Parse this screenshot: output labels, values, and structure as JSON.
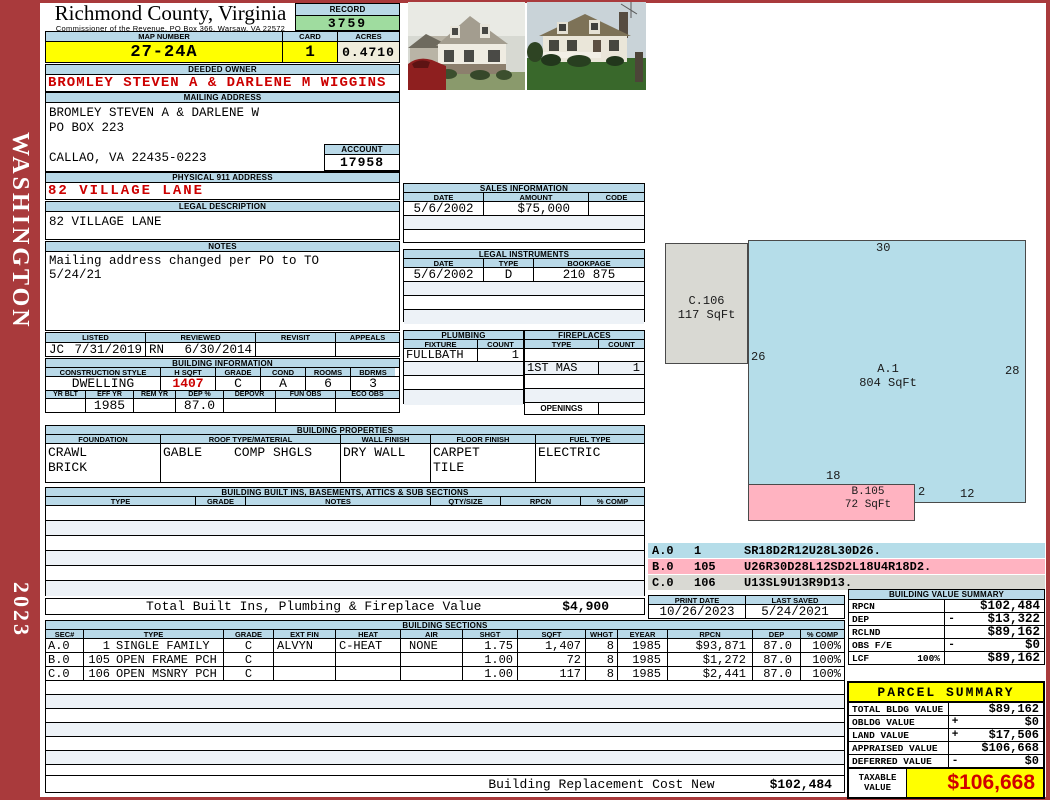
{
  "sidebar": {
    "district": "WASHINGTON",
    "year": "2023"
  },
  "header": {
    "title": "Richmond County, Virginia",
    "subtitle": "Commissioner of the Revenue, PO Box 366, Warsaw, VA 22572",
    "record_label": "RECORD",
    "record_value": "3759",
    "map_label": "MAP NUMBER",
    "map_value": "27-24A",
    "card_label": "CARD",
    "card_value": "1",
    "acres_label": "ACRES",
    "acres_value": "0.4710"
  },
  "owner": {
    "label": "DEEDED OWNER",
    "value": "BROMLEY STEVEN A & DARLENE M WIGGINS"
  },
  "mailing": {
    "label": "MAILING ADDRESS",
    "line1": "BROMLEY STEVEN A & DARLENE W",
    "line2": "PO BOX 223",
    "line3": "CALLAO, VA 22435-0223"
  },
  "account": {
    "label": "ACCOUNT",
    "value": "17958"
  },
  "physical": {
    "label": "PHYSICAL 911 ADDRESS",
    "value": "82 VILLAGE LANE"
  },
  "legal": {
    "label": "LEGAL DESCRIPTION",
    "value": "82 VILLAGE LANE"
  },
  "notes": {
    "label": "NOTES",
    "line1": "Mailing address changed per PO to TO",
    "line2": "5/24/21"
  },
  "visits": {
    "listed_label": "LISTED",
    "reviewed_label": "REVIEWED",
    "revisit_label": "REVISIT",
    "appeals_label": "APPEALS",
    "listed_code": "JC",
    "listed_date": "7/31/2019",
    "reviewed_code": "RN",
    "reviewed_date": "6/30/2014",
    "revisit_value": "",
    "appeals_value": ""
  },
  "building_info": {
    "section_label": "BUILDING INFORMATION",
    "style_label": "CONSTRUCTION STYLE",
    "style": "DWELLING",
    "hsqft_label": "H SQFT",
    "hsqft": "1407",
    "grade_label": "GRADE",
    "grade": "C",
    "cond_label": "COND",
    "cond": "A",
    "rooms_label": "ROOMS",
    "rooms": "6",
    "bdrms_label": "BDRMS",
    "bdrms": "3",
    "yrblt_label": "YR BLT",
    "yrblt": "",
    "effyr_label": "EFF YR",
    "effyr": "1985",
    "remyr_label": "REM YR",
    "remyr": "",
    "dep_label": "DEP %",
    "dep": "87.0",
    "depovr_label": "DEPOVR",
    "depovr": "",
    "funobs_label": "FUN OBS",
    "funobs": "",
    "ecoobs_label": "ECO OBS",
    "ecoobs": ""
  },
  "properties": {
    "section_label": "BUILDING PROPERTIES",
    "foundation_label": "FOUNDATION",
    "foundation1": "CRAWL",
    "foundation2": "BRICK",
    "roof_label": "ROOF TYPE/MATERIAL",
    "roof_type": "GABLE",
    "roof_material": "COMP SHGLS",
    "wall_label": "WALL FINISH",
    "wall": "DRY WALL",
    "floor_label": "FLOOR FINISH",
    "floor1": "CARPET",
    "floor2": "TILE",
    "fuel_label": "FUEL TYPE",
    "fuel": "ELECTRIC"
  },
  "builtins": {
    "section_label": "BUILDING BUILT INS, BASEMENTS, ATTICS & SUB SECTIONS",
    "headers": [
      "TYPE",
      "GRADE",
      "NOTES",
      "QTY/SIZE",
      "RPCN",
      "% COMP"
    ]
  },
  "totals": {
    "built_ins_label": "Total Built Ins, Plumbing & Fireplace Value",
    "built_ins_value": "$4,900",
    "replacement_label": "Building Replacement Cost New",
    "replacement_value": "$102,484"
  },
  "sales": {
    "section_label": "SALES INFORMATION",
    "date_label": "DATE",
    "amount_label": "AMOUNT",
    "code_label": "CODE",
    "rows": [
      {
        "date": "5/6/2002",
        "amount": "$75,000",
        "code": ""
      }
    ]
  },
  "instruments": {
    "section_label": "LEGAL INSTRUMENTS",
    "date_label": "DATE",
    "type_label": "TYPE",
    "bookpage_label": "BOOKPAGE",
    "rows": [
      {
        "date": "5/6/2002",
        "type": "D",
        "bookpage": "210 875"
      }
    ]
  },
  "plumbing": {
    "section_label": "PLUMBING",
    "fixture_label": "FIXTURE",
    "count_label": "COUNT",
    "rows": [
      {
        "fixture": "FULLBATH",
        "count": "1"
      }
    ]
  },
  "fireplaces": {
    "section_label": "FIREPLACES",
    "type_label": "TYPE",
    "count_label": "COUNT",
    "row2_type": "1ST MAS",
    "row2_count": "1",
    "openings_label": "OPENINGS"
  },
  "print_info": {
    "print_date_label": "PRINT DATE",
    "print_date": "10/26/2023",
    "last_saved_label": "LAST SAVED",
    "last_saved": "5/24/2021"
  },
  "building_sections": {
    "section_label": "BUILDING SECTIONS",
    "headers": [
      "SEC#",
      "TYPE",
      "GRADE",
      "EXT FIN",
      "HEAT",
      "AIR",
      "SHGT",
      "SQFT",
      "WHGT",
      "EYEAR",
      "RPCN",
      "DEP",
      "% COMP"
    ],
    "rows": [
      {
        "sec": "A.0",
        "num": "1",
        "type": "SINGLE FAMILY",
        "grade": "C",
        "ext_fin": "ALVYN",
        "heat": "C-HEAT",
        "air": "NONE",
        "shgt": "1.75",
        "sqft": "1,407",
        "whgt": "8",
        "eyear": "1985",
        "rpcn": "$93,871",
        "dep": "87.0",
        "comp": "100%"
      },
      {
        "sec": "B.0",
        "num": "105",
        "type": "OPEN FRAME PCH",
        "grade": "C",
        "ext_fin": "",
        "heat": "",
        "air": "",
        "shgt": "1.00",
        "sqft": "72",
        "whgt": "8",
        "eyear": "1985",
        "rpcn": "$1,272",
        "dep": "87.0",
        "comp": "100%"
      },
      {
        "sec": "C.0",
        "num": "106",
        "type": "OPEN MSNRY PCH",
        "grade": "C",
        "ext_fin": "",
        "heat": "",
        "air": "",
        "shgt": "1.00",
        "sqft": "117",
        "whgt": "8",
        "eyear": "1985",
        "rpcn": "$2,441",
        "dep": "87.0",
        "comp": "100%"
      }
    ]
  },
  "sketch": {
    "a": {
      "label": "A.1",
      "sqft": "804 SqFt",
      "dim_top": "30",
      "dim_left": "26",
      "dim_right": "28",
      "dim_bottom": "18",
      "dim_step": "2",
      "dim_bottom_right": "12"
    },
    "b": {
      "label": "B.105",
      "sqft": "72 SqFt"
    },
    "c": {
      "label": "C.106",
      "sqft": "117 SqFt"
    },
    "legend": [
      {
        "sec": "A.0",
        "num": "1",
        "trace": "SR18D2R12U28L30D26."
      },
      {
        "sec": "B.0",
        "num": "105",
        "trace": "U26R30D28L12SD2L18U4R18D2."
      },
      {
        "sec": "C.0",
        "num": "106",
        "trace": "U13SL9U13R9D13."
      }
    ]
  },
  "value_summary": {
    "section_label": "BUILDING VALUE SUMMARY",
    "rows": [
      {
        "label": "RPCN",
        "pct": "",
        "op": "",
        "value": "$102,484"
      },
      {
        "label": "DEP",
        "pct": "",
        "op": "-",
        "value": "$13,322"
      },
      {
        "label": "RCLND",
        "pct": "",
        "op": "",
        "value": "$89,162"
      },
      {
        "label": "OBS F/E",
        "pct": "",
        "op": "-",
        "value": "$0"
      },
      {
        "label": "LCF",
        "pct": "100%",
        "op": "",
        "value": "$89,162"
      }
    ]
  },
  "parcel_summary": {
    "section_label": "PARCEL SUMMARY",
    "rows": [
      {
        "label": "TOTAL BLDG VALUE",
        "op": "",
        "value": "$89,162"
      },
      {
        "label": "OBLDG VALUE",
        "op": "+",
        "value": "$0"
      },
      {
        "label": "LAND VALUE",
        "op": "+",
        "value": "$17,506"
      },
      {
        "label": "APPRAISED VALUE",
        "op": "",
        "value": "$106,668"
      },
      {
        "label": "DEFERRED VALUE",
        "op": "-",
        "value": "$0"
      }
    ],
    "taxable_label": "TAXABLE VALUE",
    "taxable_value": "$106,668"
  },
  "colors": {
    "header_blue": "#b9d9e8",
    "highlight_yellow": "#ffff00",
    "record_green": "#9fdc9f",
    "acres_cream": "#f0eddc",
    "alert_red": "#cc0000",
    "frame_red": "#a93a3c",
    "sketch_blue": "#b5dde9",
    "sketch_pink": "#ffb3c1",
    "sketch_gray": "#d9d9d3"
  }
}
